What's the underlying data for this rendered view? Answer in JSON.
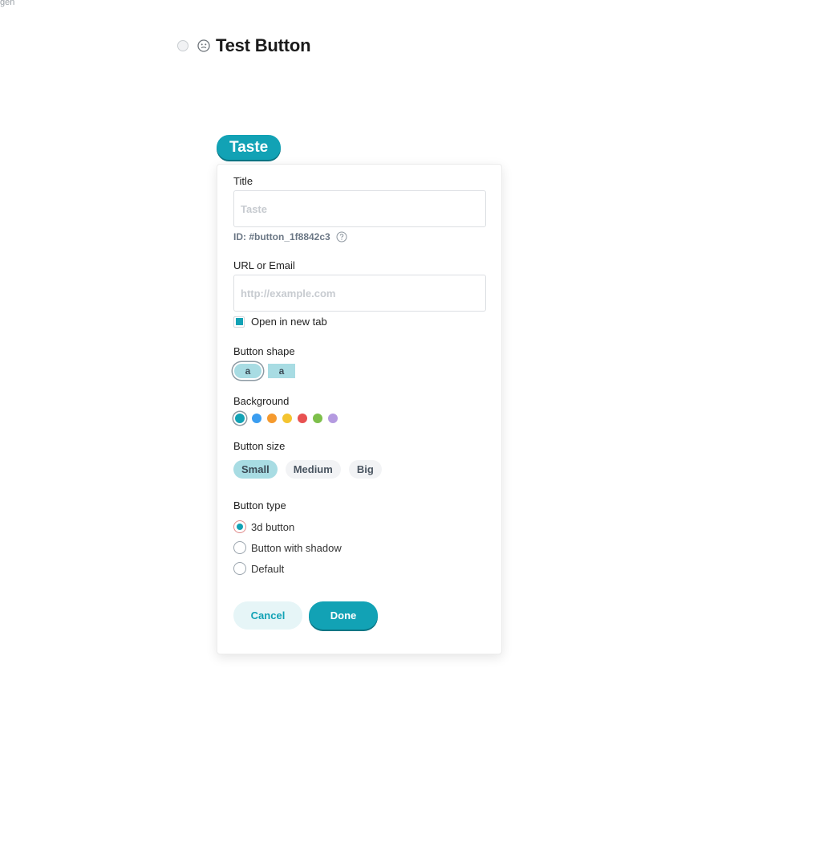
{
  "corner_label": "gen",
  "header": {
    "title": "Test Button",
    "status_icon": "circle-icon",
    "emoji_icon": "smiley-icon"
  },
  "preview_button": {
    "label": "Taste",
    "color": "#12a2b5"
  },
  "form": {
    "title": {
      "label": "Title",
      "value": "",
      "placeholder": "Taste",
      "id_text": "ID: #button_1f8842c3",
      "help_icon": "question-circle-icon"
    },
    "url": {
      "label": "URL or Email",
      "value": "",
      "placeholder": "http://example.com"
    },
    "open_in_new_tab": {
      "label": "Open in new tab",
      "checked": true
    },
    "button_shape": {
      "label": "Button shape",
      "options": [
        {
          "name": "rounded",
          "glyph": "a",
          "selected": true
        },
        {
          "name": "square",
          "glyph": "a",
          "selected": false
        }
      ]
    },
    "background": {
      "label": "Background",
      "swatches": [
        {
          "color": "#12a2b5",
          "selected": true
        },
        {
          "color": "#3a9df0",
          "selected": false
        },
        {
          "color": "#f59a2e",
          "selected": false
        },
        {
          "color": "#f4c430",
          "selected": false
        },
        {
          "color": "#e85151",
          "selected": false
        },
        {
          "color": "#7dbf4a",
          "selected": false
        },
        {
          "color": "#b49ae0",
          "selected": false
        }
      ]
    },
    "button_size": {
      "label": "Button size",
      "options": [
        {
          "label": "Small",
          "selected": true
        },
        {
          "label": "Medium",
          "selected": false
        },
        {
          "label": "Big",
          "selected": false
        }
      ]
    },
    "button_type": {
      "label": "Button type",
      "options": [
        {
          "label": "3d button",
          "selected": true
        },
        {
          "label": "Button with shadow",
          "selected": false
        },
        {
          "label": "Default",
          "selected": false
        }
      ]
    },
    "actions": {
      "cancel": "Cancel",
      "done": "Done"
    }
  }
}
